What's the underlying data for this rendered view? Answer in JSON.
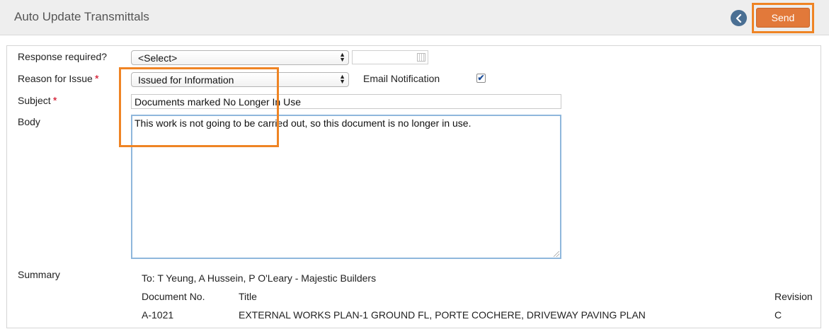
{
  "header": {
    "title": "Auto Update Transmittals",
    "send_label": "Send"
  },
  "form": {
    "response_required": {
      "label": "Response required?",
      "value": "<Select>"
    },
    "reason": {
      "label": "Reason for Issue",
      "required_mark": "*",
      "value": "Issued for Information"
    },
    "email_notification": {
      "label": "Email Notification",
      "checked": true,
      "check_glyph": "✔"
    },
    "subject": {
      "label": "Subject",
      "required_mark": "*",
      "value": "Documents marked No Longer In Use"
    },
    "body": {
      "label": "Body",
      "value": "This work is not going to be carried out, so this document is no longer in use."
    }
  },
  "summary": {
    "label": "Summary",
    "to": "To: T Yeung, A Hussein, P O'Leary - Majestic Builders",
    "columns": [
      "Document No.",
      "Title",
      "Revision"
    ],
    "rows": [
      {
        "doc_no": "A-1021",
        "title": "EXTERNAL WORKS PLAN-1 GROUND FL, PORTE COCHERE, DRIVEWAY PAVING PLAN",
        "revision": "C"
      }
    ]
  },
  "colors": {
    "accent_orange": "#e2793a",
    "highlight": "#ef8424",
    "back_button": "#4a6f93",
    "required": "#d0021b"
  },
  "icons": {
    "back": "chevron-left-icon",
    "select_arrows": "updown-arrows-icon",
    "calendar": "calendar-icon"
  }
}
